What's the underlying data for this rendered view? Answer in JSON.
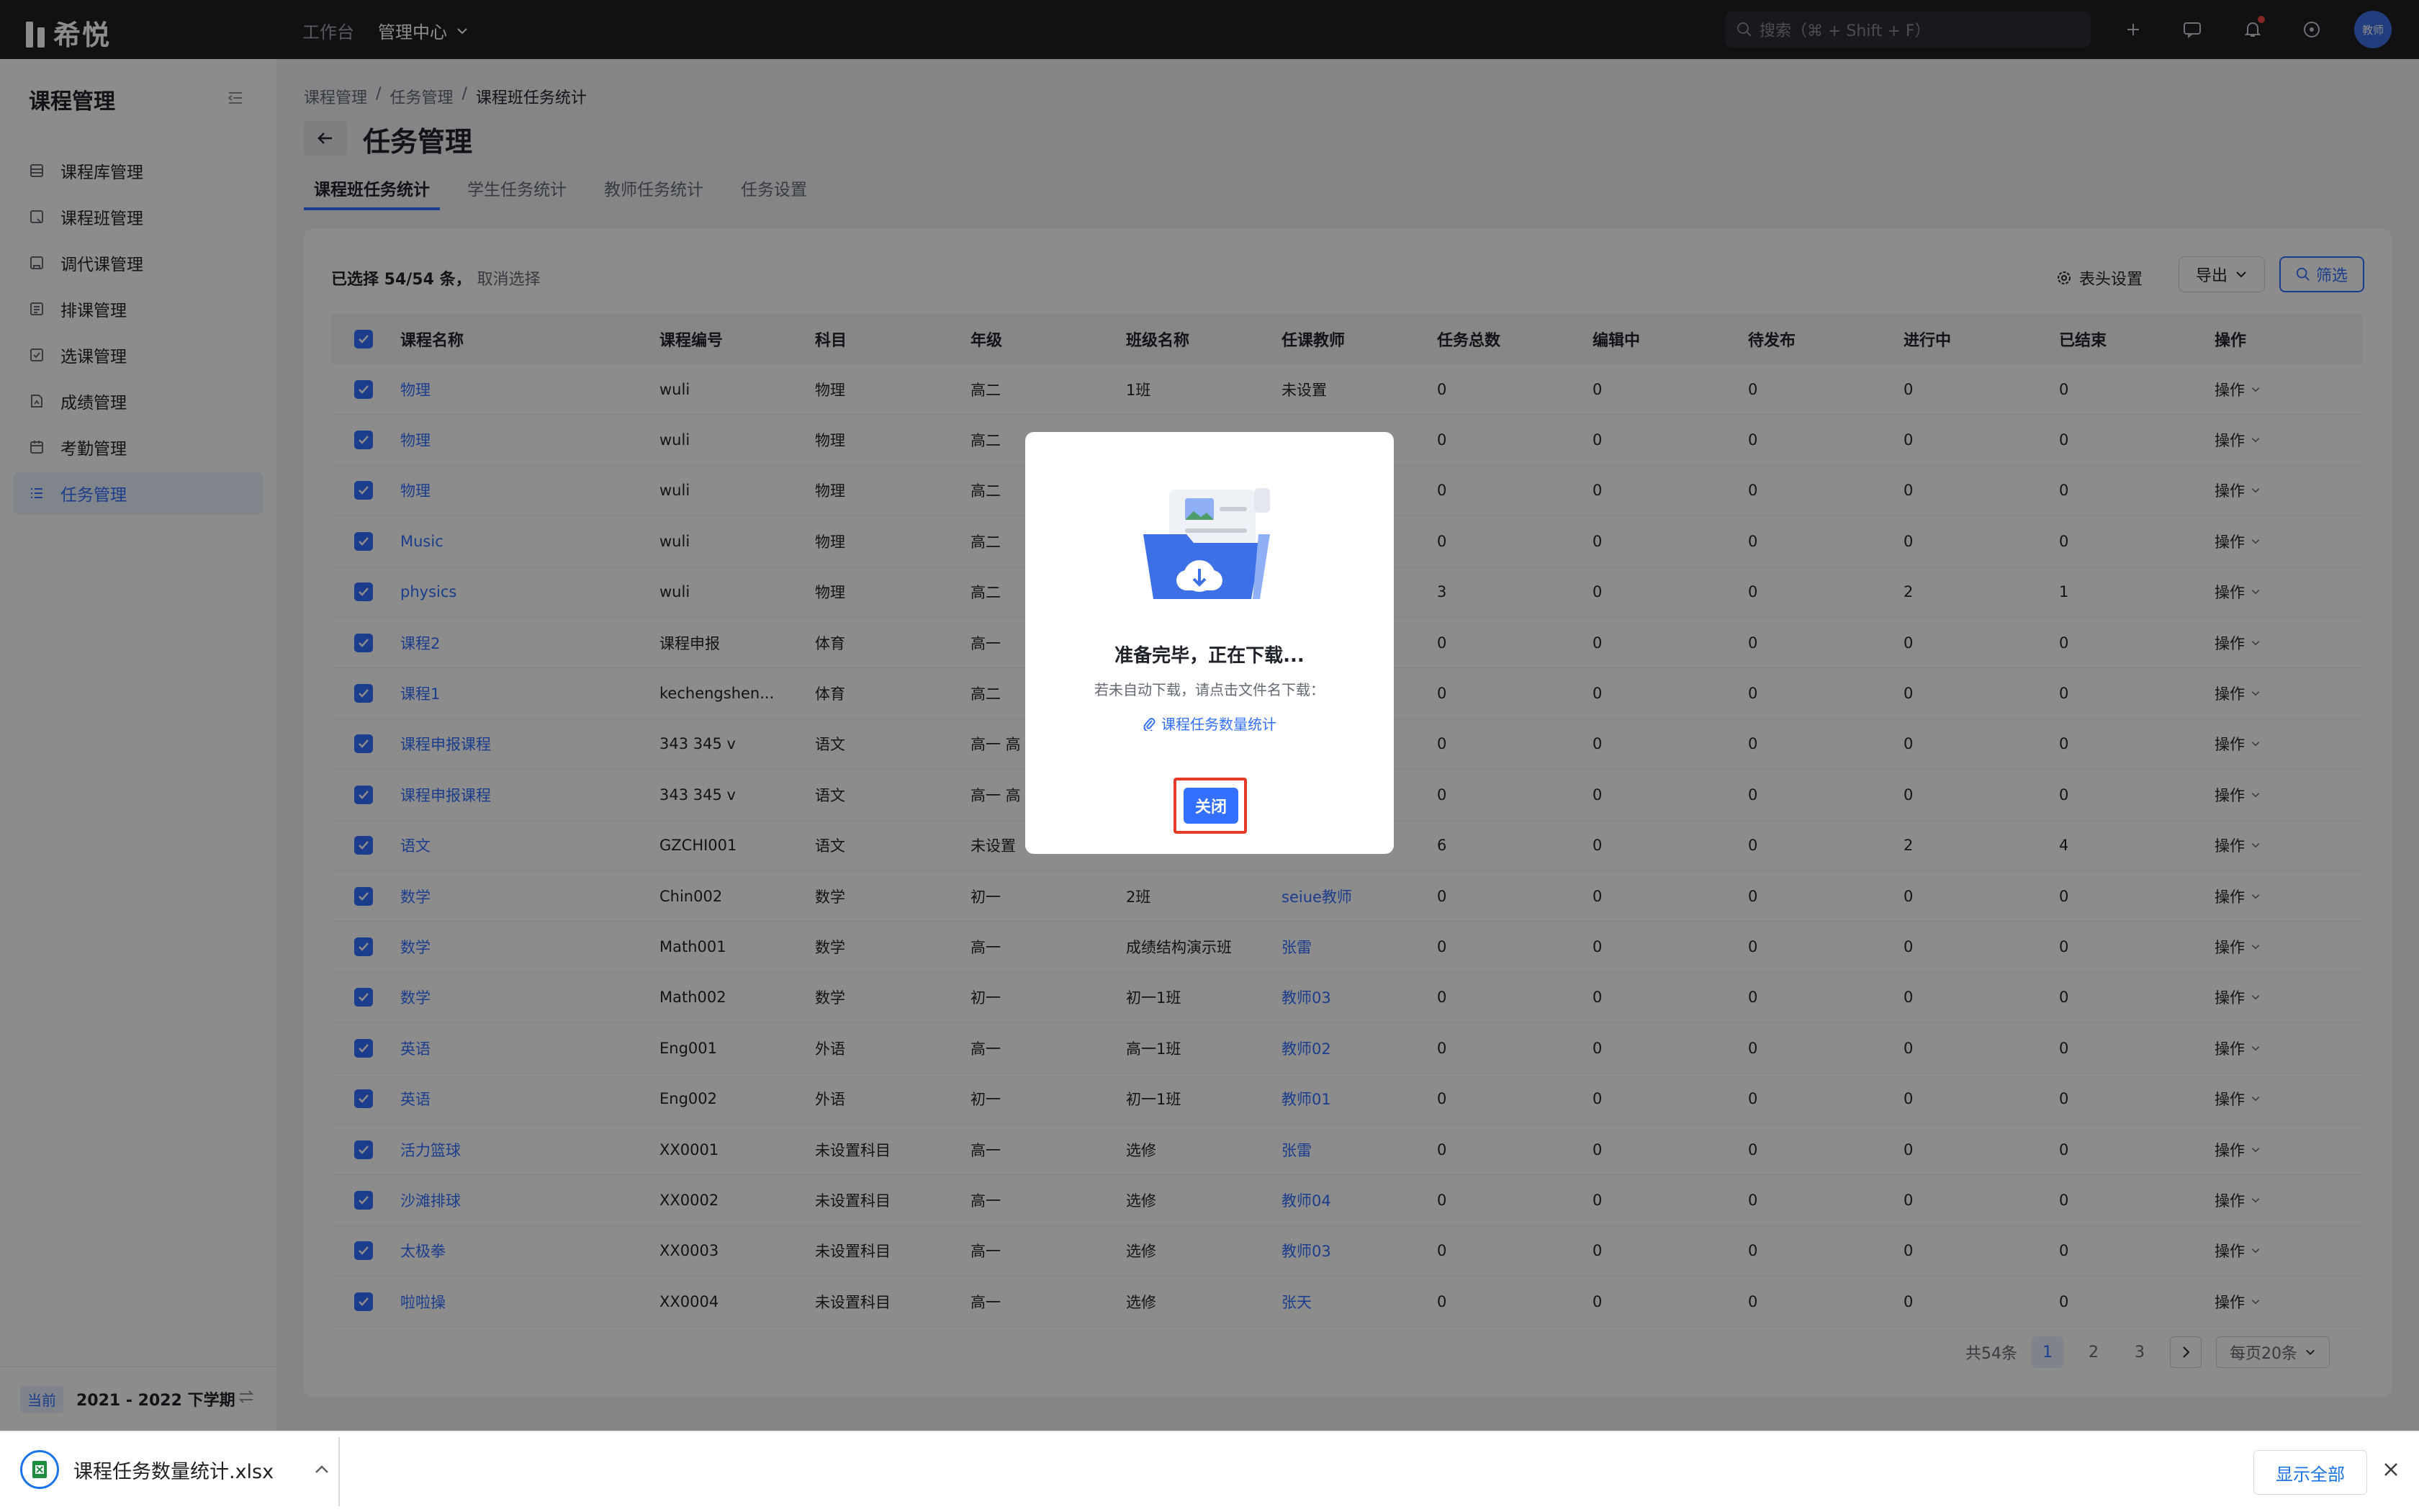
{
  "topbar": {
    "logo_text": "希悦",
    "nav": [
      "工作台",
      "管理中心"
    ],
    "search_placeholder": "搜索（⌘ + Shift + F）",
    "avatar_text": "教师"
  },
  "sidebar": {
    "title": "课程管理",
    "items": [
      {
        "label": "课程库管理",
        "icon": "course-library-icon"
      },
      {
        "label": "课程班管理",
        "icon": "class-icon"
      },
      {
        "label": "调代课管理",
        "icon": "substitute-icon"
      },
      {
        "label": "排课管理",
        "icon": "schedule-icon"
      },
      {
        "label": "选课管理",
        "icon": "selection-icon"
      },
      {
        "label": "成绩管理",
        "icon": "grade-icon"
      },
      {
        "label": "考勤管理",
        "icon": "attendance-icon"
      },
      {
        "label": "任务管理",
        "icon": "task-icon",
        "active": true
      }
    ],
    "term_tag": "当前",
    "term_text": "2021 - 2022 下学期"
  },
  "main": {
    "breadcrumb": [
      "课程管理",
      "任务管理",
      "课程班任务统计"
    ],
    "page_title": "任务管理",
    "tabs": [
      "课程班任务统计",
      "学生任务统计",
      "教师任务统计",
      "任务设置"
    ],
    "selection": {
      "count_text": "已选择 54/54 条，",
      "cancel": "取消选择"
    },
    "column_settings": "表头设置",
    "export": "导出",
    "filter": "筛选",
    "columns": [
      "课程名称",
      "课程编号",
      "科目",
      "年级",
      "班级名称",
      "任课教师",
      "任务总数",
      "编辑中",
      "待发布",
      "进行中",
      "已结束",
      "操作"
    ],
    "rows": [
      [
        "物理",
        "wuli",
        "物理",
        "高二",
        "1班",
        "未设置",
        "0",
        "0",
        "0",
        "0",
        "0",
        "操作"
      ],
      [
        "物理",
        "wuli",
        "物理",
        "高二",
        "",
        "",
        "0",
        "0",
        "0",
        "0",
        "0",
        "操作"
      ],
      [
        "物理",
        "wuli",
        "物理",
        "高二",
        "",
        "",
        "0",
        "0",
        "0",
        "0",
        "0",
        "操作"
      ],
      [
        "Music",
        "wuli",
        "物理",
        "高二",
        "",
        "",
        "0",
        "0",
        "0",
        "0",
        "0",
        "操作"
      ],
      [
        "physics",
        "wuli",
        "物理",
        "高二",
        "",
        "",
        "3",
        "0",
        "0",
        "2",
        "1",
        "操作"
      ],
      [
        "课程2",
        "课程申报",
        "体育",
        "高一",
        "",
        "",
        "0",
        "0",
        "0",
        "0",
        "0",
        "操作"
      ],
      [
        "课程1",
        "kechengshen...",
        "体育",
        "高二",
        "",
        "",
        "0",
        "0",
        "0",
        "0",
        "0",
        "操作"
      ],
      [
        "课程申报课程",
        "343 345 v",
        "语文",
        "高一 高",
        "",
        "",
        "0",
        "0",
        "0",
        "0",
        "0",
        "操作"
      ],
      [
        "课程申报课程",
        "343 345 v",
        "语文",
        "高一 高",
        "",
        "",
        "0",
        "0",
        "0",
        "0",
        "0",
        "操作"
      ],
      [
        "语文",
        "GZCHI001",
        "语文",
        "未设置",
        "",
        "",
        "6",
        "0",
        "0",
        "2",
        "4",
        "操作"
      ],
      [
        "数学",
        "Chin002",
        "数学",
        "初一",
        "2班",
        "seiue教师",
        "0",
        "0",
        "0",
        "0",
        "0",
        "操作"
      ],
      [
        "数学",
        "Math001",
        "数学",
        "高一",
        "成绩结构演示班",
        "张雷",
        "0",
        "0",
        "0",
        "0",
        "0",
        "操作"
      ],
      [
        "数学",
        "Math002",
        "数学",
        "初一",
        "初一1班",
        "教师03",
        "0",
        "0",
        "0",
        "0",
        "0",
        "操作"
      ],
      [
        "英语",
        "Eng001",
        "外语",
        "高一",
        "高一1班",
        "教师02",
        "0",
        "0",
        "0",
        "0",
        "0",
        "操作"
      ],
      [
        "英语",
        "Eng002",
        "外语",
        "初一",
        "初一1班",
        "教师01",
        "0",
        "0",
        "0",
        "0",
        "0",
        "操作"
      ],
      [
        "活力篮球",
        "XX0001",
        "未设置科目",
        "高一",
        "选修",
        "张雷",
        "0",
        "0",
        "0",
        "0",
        "0",
        "操作"
      ],
      [
        "沙滩排球",
        "XX0002",
        "未设置科目",
        "高一",
        "选修",
        "教师04",
        "0",
        "0",
        "0",
        "0",
        "0",
        "操作"
      ],
      [
        "太极拳",
        "XX0003",
        "未设置科目",
        "高一",
        "选修",
        "教师03",
        "0",
        "0",
        "0",
        "0",
        "0",
        "操作"
      ],
      [
        "啦啦操",
        "XX0004",
        "未设置科目",
        "高一",
        "选修",
        "张天",
        "0",
        "0",
        "0",
        "0",
        "0",
        "操作"
      ]
    ],
    "pager": {
      "total": "共54条",
      "pages": [
        "1",
        "2",
        "3"
      ],
      "current": "1",
      "page_size": "每页20条"
    }
  },
  "modal": {
    "title": "准备完毕，正在下载...",
    "subtitle": "若未自动下载，请点击文件名下载：",
    "file_link": "课程任务数量统计",
    "close": "关闭"
  },
  "download_bar": {
    "filename": "课程任务数量统计.xlsx",
    "show_all": "显示全部"
  },
  "colors": {
    "accent": "#3370ff",
    "topbar": "#1f2026",
    "highlight": "#e53a2a"
  }
}
